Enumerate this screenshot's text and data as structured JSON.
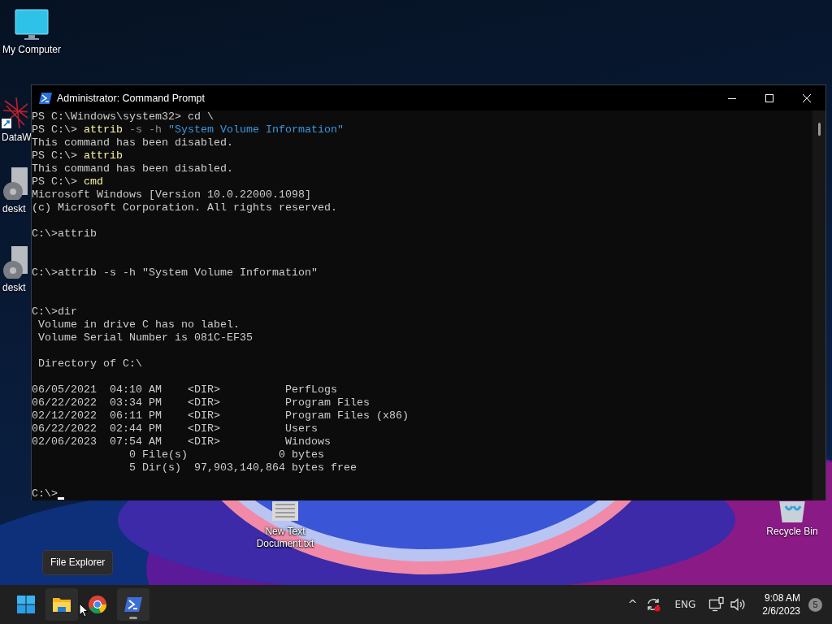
{
  "desktop_icons": [
    {
      "kind": "monitor",
      "label": "My Computer"
    },
    {
      "kind": "app",
      "label": "DataW"
    },
    {
      "kind": "gear",
      "label": "deskt"
    },
    {
      "kind": "gear",
      "label": "deskt"
    },
    {
      "kind": "textfile",
      "label": "New Text Document.txt"
    },
    {
      "kind": "recycle",
      "label": "Recycle Bin"
    }
  ],
  "window": {
    "title": "Administrator: Command Prompt",
    "lines": [
      {
        "kind": "text",
        "segments": [
          {
            "kind": "text",
            "text": "PS C:\\Windows\\system32> cd \\"
          }
        ]
      },
      {
        "kind": "text",
        "segments": [
          {
            "kind": "text",
            "text": "PS C:\\> "
          },
          {
            "kind": "command",
            "text": "attrib"
          },
          {
            "kind": "param",
            "text": " -s -h "
          },
          {
            "kind": "string",
            "text": "\"System Volume Information\""
          }
        ]
      },
      {
        "kind": "text",
        "segments": [
          {
            "kind": "text",
            "text": "This command has been disabled."
          }
        ]
      },
      {
        "kind": "text",
        "segments": [
          {
            "kind": "text",
            "text": "PS C:\\> "
          },
          {
            "kind": "command",
            "text": "attrib"
          }
        ]
      },
      {
        "kind": "text",
        "segments": [
          {
            "kind": "text",
            "text": "This command has been disabled."
          }
        ]
      },
      {
        "kind": "text",
        "segments": [
          {
            "kind": "text",
            "text": "PS C:\\> "
          },
          {
            "kind": "command",
            "text": "cmd"
          }
        ]
      },
      {
        "kind": "text",
        "segments": [
          {
            "kind": "text",
            "text": "Microsoft Windows [Version 10.0.22000.1098]"
          }
        ]
      },
      {
        "kind": "text",
        "segments": [
          {
            "kind": "text",
            "text": "(c) Microsoft Corporation. All rights reserved."
          }
        ]
      },
      {
        "kind": "blank"
      },
      {
        "kind": "text",
        "segments": [
          {
            "kind": "text",
            "text": "C:\\>attrib"
          }
        ]
      },
      {
        "kind": "blank"
      },
      {
        "kind": "blank"
      },
      {
        "kind": "text",
        "segments": [
          {
            "kind": "text",
            "text": "C:\\>attrib -s -h \"System Volume Information\""
          }
        ]
      },
      {
        "kind": "blank"
      },
      {
        "kind": "blank"
      },
      {
        "kind": "text",
        "segments": [
          {
            "kind": "text",
            "text": "C:\\>dir"
          }
        ]
      },
      {
        "kind": "text",
        "segments": [
          {
            "kind": "text",
            "text": " Volume in drive C has no label."
          }
        ]
      },
      {
        "kind": "text",
        "segments": [
          {
            "kind": "text",
            "text": " Volume Serial Number is 081C-EF35"
          }
        ]
      },
      {
        "kind": "blank"
      },
      {
        "kind": "text",
        "segments": [
          {
            "kind": "text",
            "text": " Directory of C:\\"
          }
        ]
      },
      {
        "kind": "blank"
      },
      {
        "kind": "text",
        "segments": [
          {
            "kind": "text",
            "text": "06/05/2021  04:10 AM    <DIR>          PerfLogs"
          }
        ]
      },
      {
        "kind": "text",
        "segments": [
          {
            "kind": "text",
            "text": "06/22/2022  03:34 PM    <DIR>          Program Files"
          }
        ]
      },
      {
        "kind": "text",
        "segments": [
          {
            "kind": "text",
            "text": "02/12/2022  06:11 PM    <DIR>          Program Files (x86)"
          }
        ]
      },
      {
        "kind": "text",
        "segments": [
          {
            "kind": "text",
            "text": "06/22/2022  02:44 PM    <DIR>          Users"
          }
        ]
      },
      {
        "kind": "text",
        "segments": [
          {
            "kind": "text",
            "text": "02/06/2023  07:54 AM    <DIR>          Windows"
          }
        ]
      },
      {
        "kind": "text",
        "segments": [
          {
            "kind": "text",
            "text": "               0 File(s)              0 bytes"
          }
        ]
      },
      {
        "kind": "text",
        "segments": [
          {
            "kind": "text",
            "text": "               5 Dir(s)  97,903,140,864 bytes free"
          }
        ]
      },
      {
        "kind": "blank"
      },
      {
        "kind": "text",
        "segments": [
          {
            "kind": "text",
            "text": "C:\\>"
          }
        ],
        "cursor": true
      }
    ]
  },
  "tooltip": "File Explorer",
  "taskbar": {
    "apps": [
      {
        "kind": "start",
        "hovered": false,
        "running": false
      },
      {
        "kind": "folder",
        "hovered": true,
        "running": false
      },
      {
        "kind": "chrome",
        "hovered": false,
        "running": false
      },
      {
        "kind": "terminal",
        "hovered": false,
        "running": true
      }
    ],
    "tray": {
      "chevron": "^",
      "language": "ENG",
      "time": "9:08 AM",
      "date": "2/6/2023",
      "notifications": "5"
    }
  }
}
